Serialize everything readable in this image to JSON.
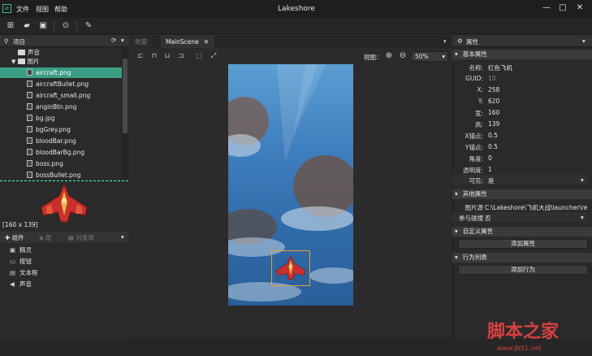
{
  "app": {
    "title": "Lakeshore"
  },
  "menu": [
    "文件",
    "视图",
    "帮助"
  ],
  "project_panel": {
    "title": "项目",
    "folders": [
      "声音",
      "图片"
    ],
    "files": [
      "aircraft.png",
      "aircraftBullet.png",
      "aircraft_small.png",
      "anginBtn.png",
      "bg.jpg",
      "bgGrey.png",
      "bloodBar.png",
      "bloodBarBg.png",
      "boss.png",
      "bossBullet.png"
    ],
    "selected": "aircraft.png",
    "preview_size": "[160 x 139]"
  },
  "components_panel": {
    "tabs": [
      "组件",
      "层",
      "对象库"
    ],
    "items": [
      "精灵",
      "按钮",
      "文本框",
      "声音"
    ]
  },
  "editor": {
    "tabs": [
      "欢迎",
      "MainScene"
    ],
    "active_tab": "MainScene",
    "view_label": "视图：",
    "zoom": "50%"
  },
  "properties": {
    "title": "属性",
    "basic_section": "基本属性",
    "rows": [
      {
        "label": "名称:",
        "value": "红色飞机"
      },
      {
        "label": "GUID:",
        "value": "10"
      },
      {
        "label": "X:",
        "value": "258"
      },
      {
        "label": "Y:",
        "value": "620"
      },
      {
        "label": "宽:",
        "value": "160"
      },
      {
        "label": "高:",
        "value": "139"
      },
      {
        "label": "X锚点:",
        "value": "0.5"
      },
      {
        "label": "Y锚点:",
        "value": "0.5"
      },
      {
        "label": "角度:",
        "value": "0"
      },
      {
        "label": "透明度:",
        "value": "1"
      }
    ],
    "visible_label": "可见:",
    "visible_value": "是",
    "other_section": "其他属性",
    "image_label": "图片源",
    "image_value": "C:\\Lakeshore\\飞机大战\\launcher\\reso",
    "collide_label": "参与碰撞",
    "collide_value": "否",
    "custom_section": "自定义属性",
    "add_prop_button": "添加属性",
    "behavior_section": "行为列表",
    "add_behavior_button": "添加行为"
  },
  "watermark": {
    "main": "脚本之家",
    "sub": "www.jb51.net"
  },
  "colors": {
    "accent": "#3a9d84",
    "bg": "#2b2b2b"
  }
}
